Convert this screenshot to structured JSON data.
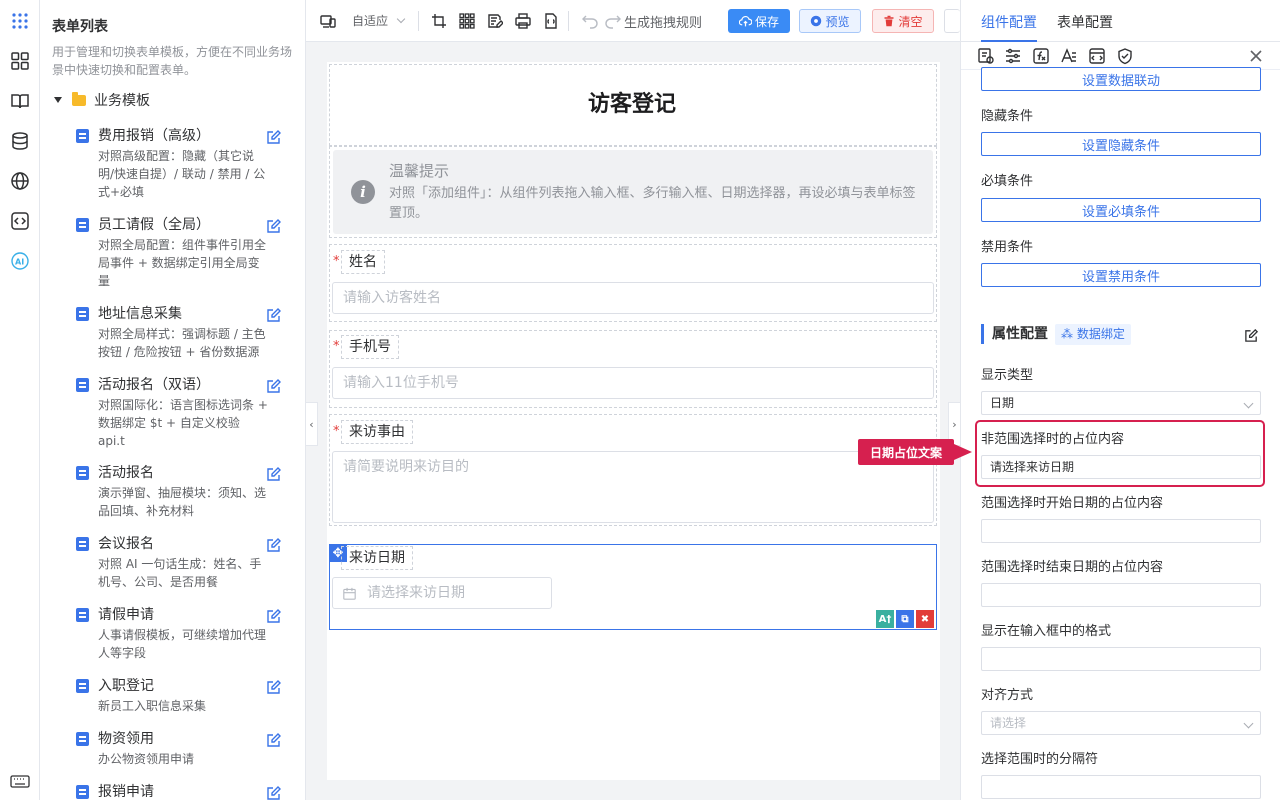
{
  "sidebar": {
    "title": "表单列表",
    "description": "用于管理和切换表单模板，方便在不同业务场景中快速切换和配置表单。",
    "group_label": "业务模板",
    "templates": [
      {
        "name": "费用报销（高级）",
        "desc": "对照高级配置：隐藏（其它说明/快速自提）/ 联动 / 禁用 / 公式+必填"
      },
      {
        "name": "员工请假（全局）",
        "desc": "对照全局配置：组件事件引用全局事件 + 数据绑定引用全局变量"
      },
      {
        "name": "地址信息采集",
        "desc": "对照全局样式：强调标题 / 主色按钮 / 危险按钮 + 省份数据源"
      },
      {
        "name": "活动报名（双语）",
        "desc": "对照国际化：语言图标选词条 + 数据绑定 $t + 自定义校验 api.t"
      },
      {
        "name": "活动报名",
        "desc": "演示弹窗、抽屉模块：须知、选品回填、补充材料"
      },
      {
        "name": "会议报名",
        "desc": "对照 AI 一句话生成：姓名、手机号、公司、是否用餐"
      },
      {
        "name": "请假申请",
        "desc": "人事请假模板，可继续增加代理人等字段"
      },
      {
        "name": "入职登记",
        "desc": "新员工入职信息采集"
      },
      {
        "name": "物资领用",
        "desc": "办公物资领用申请"
      },
      {
        "name": "报销申请",
        "desc": ""
      }
    ]
  },
  "toolbar": {
    "mode": "自适应",
    "generate_rules": "生成拖拽规则",
    "save": "保存",
    "preview": "预览",
    "clear": "清空"
  },
  "form": {
    "title": "访客登记",
    "tip_title": "温馨提示",
    "tip_body": "对照「添加组件」：从组件列表拖入输入框、多行输入框、日期选择器，再设必填与表单标签置顶。",
    "fields": [
      {
        "label": "姓名",
        "placeholder": "请输入访客姓名"
      },
      {
        "label": "手机号",
        "placeholder": "请输入11位手机号"
      },
      {
        "label": "来访事由",
        "placeholder": "请简要说明来访目的"
      },
      {
        "label": "来访日期",
        "placeholder": "请选择来访日期"
      }
    ]
  },
  "panel": {
    "tabs": [
      "组件配置",
      "表单配置"
    ],
    "link_btn": "设置数据联动",
    "hidden_label": "隐藏条件",
    "hidden_btn": "设置隐藏条件",
    "required_label": "必填条件",
    "required_btn": "设置必填条件",
    "disabled_label": "禁用条件",
    "disabled_btn": "设置禁用条件",
    "section": "属性配置",
    "data_bind": "数据绑定",
    "display_type_label": "显示类型",
    "display_type_value": "日期",
    "placeholder_label": "非范围选择时的占位内容",
    "placeholder_value": "请选择来访日期",
    "range_start_label": "范围选择时开始日期的占位内容",
    "range_end_label": "范围选择时结束日期的占位内容",
    "format_label": "显示在输入框中的格式",
    "align_label": "对齐方式",
    "align_placeholder": "请选择",
    "separator_label": "选择范围时的分隔符"
  },
  "annotation": {
    "callout": "日期占位文案"
  },
  "colors": {
    "primary": "#3a74e8",
    "danger": "#e23c39",
    "highlight": "#d6204f"
  }
}
